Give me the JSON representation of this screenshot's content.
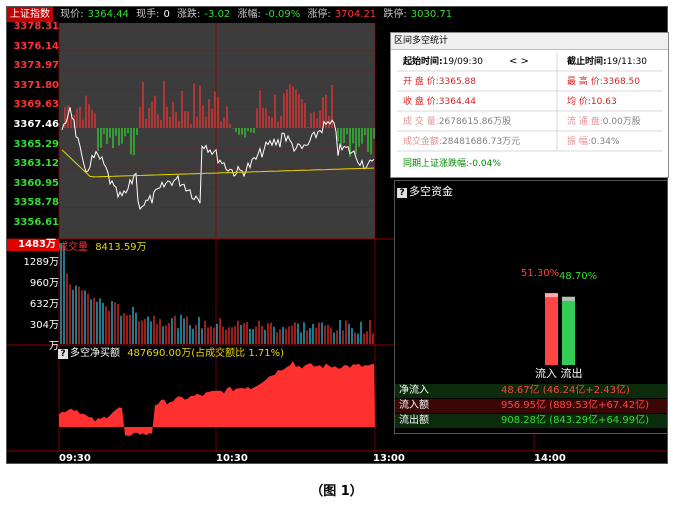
{
  "topbar": {
    "title": "上证指数",
    "price_label": "现价:",
    "price": "3364.44",
    "hand_label": "现手:",
    "hand": "0",
    "change_label": "涨跌:",
    "change": "-3.02",
    "pct_label": "涨幅:",
    "pct": "-0.09%",
    "limit_up_label": "涨停:",
    "limit_up": "3704.21",
    "limit_down_label": "跌停:",
    "limit_down": "3030.71"
  },
  "price_axis": {
    "ticks": [
      "3378.31",
      "3376.14",
      "3373.97",
      "3371.80",
      "3369.63",
      "3367.46",
      "3365.29",
      "3363.12",
      "3360.95",
      "3358.78",
      "3356.61"
    ],
    "colors": [
      "#ff3333",
      "#ff3333",
      "#ff3333",
      "#ff3333",
      "#ff3333",
      "#ffffff",
      "#33dd33",
      "#33dd33",
      "#33dd33",
      "#33dd33",
      "#33dd33"
    ]
  },
  "volume": {
    "badge": "1483万",
    "label": "成交量",
    "value": "8413.59万",
    "ticks": [
      "1289万",
      "960万",
      "632万",
      "304万",
      "万"
    ]
  },
  "net_buy": {
    "label": "多空净买额",
    "value": "487690.00万(占成交额比 1.71%)"
  },
  "time_axis": [
    "09:30",
    "10:30",
    "13:00",
    "14:00"
  ],
  "popup": {
    "title": "区间多空统计",
    "start_label": "起始时间:",
    "start_value": "19/09:30",
    "nav": "< >",
    "end_label": "截止时间:",
    "end_value": "19/11:30",
    "open_label": "开 盘 价:",
    "open_value": "3365.88",
    "high_label": "最 高 价:",
    "high_value": "3368.50",
    "close_label": "收 盘 价:",
    "close_value": "3364.44",
    "avg_label": "均    价:",
    "avg_value": "10.63",
    "vol_label": "成 交 量:",
    "vol_value": "2678615.86万股",
    "float_label": "流 通 盘:",
    "float_value": "0.00万股",
    "amount_label": "成交金额:",
    "amount_value": "28481686.73万元",
    "amp_label": "振    幅:",
    "amp_value": "0.34%",
    "period_label": "同期上证涨跌幅:",
    "period_value": "-0.04%"
  },
  "money_flow": {
    "title": "多空资金",
    "inflow_pct": "51.30%",
    "outflow_pct": "48.70%",
    "inflow_fraction": 0.513,
    "outflow_fraction": 0.487,
    "bar_labels": "流入 流出",
    "rows": [
      {
        "label": "净流入",
        "value": "48.67亿 (46.24亿+2.43亿)",
        "color": "#ff4444"
      },
      {
        "label": "流入额",
        "value": "956.95亿 (889.53亿+67.42亿)",
        "color": "#ff4444"
      },
      {
        "label": "流出额",
        "value": "908.28亿 (843.29亿+64.99亿)",
        "color": "#33dd33"
      }
    ]
  },
  "caption": "（图 1）",
  "colors": {
    "up": "#ff3333",
    "down": "#33dd33",
    "price_line": "#ffffff",
    "avg_line": "#e8d800",
    "net_area": "#ff3030",
    "grid": "#8b0000"
  }
}
